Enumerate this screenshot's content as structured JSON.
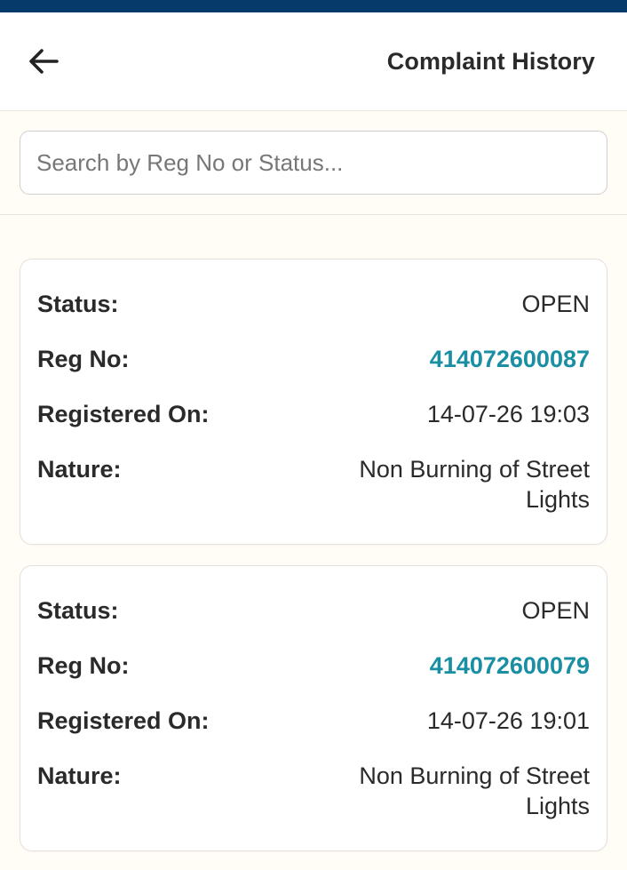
{
  "header": {
    "title": "Complaint History",
    "back_icon": "arrow-left-icon"
  },
  "search": {
    "placeholder": "Search by Reg No or Status...",
    "value": ""
  },
  "colors": {
    "status_bar": "#063a6b",
    "reg_link": "#1a8fa4",
    "background": "#fffdf6"
  },
  "labels": {
    "status": "Status:",
    "reg_no": "Reg No:",
    "registered_on": "Registered On:",
    "nature": "Nature:"
  },
  "complaints": [
    {
      "status": "OPEN",
      "reg_no": "414072600087",
      "registered_on": "14-07-26 19:03",
      "nature": "Non Burning of Street Lights"
    },
    {
      "status": "OPEN",
      "reg_no": "414072600079",
      "registered_on": "14-07-26 19:01",
      "nature": "Non Burning of Street Lights"
    }
  ]
}
